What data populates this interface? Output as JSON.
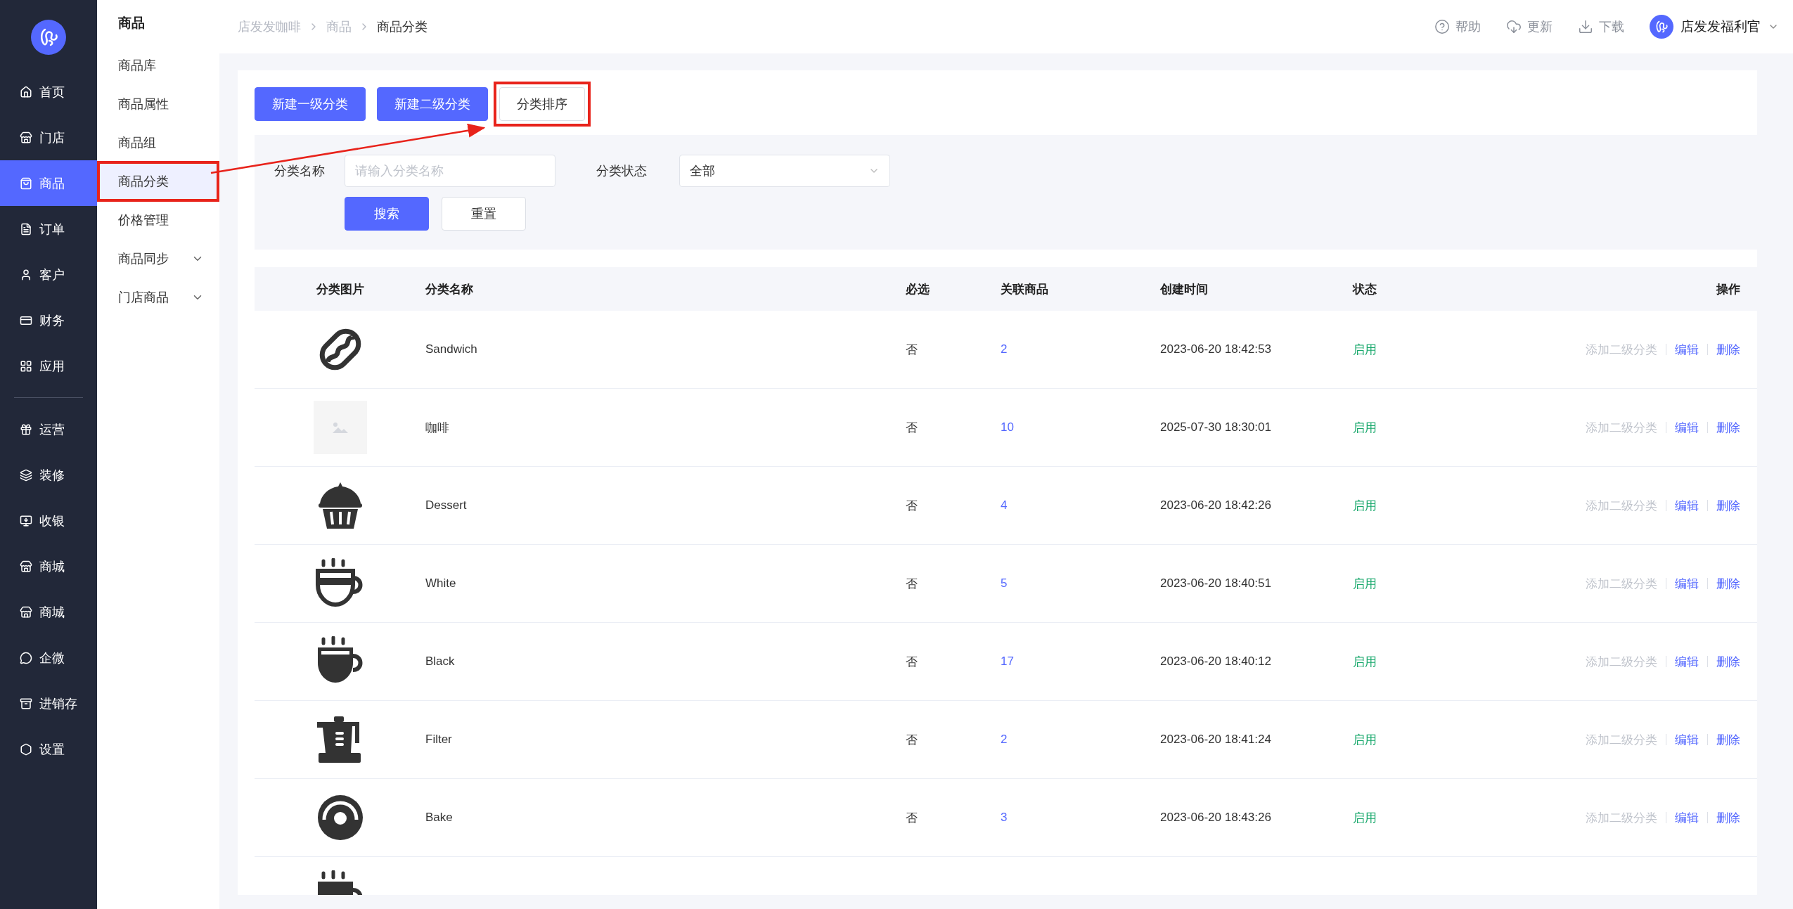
{
  "nav": [
    {
      "label": "首页",
      "selected": false
    },
    {
      "label": "门店",
      "selected": false
    },
    {
      "label": "商品",
      "selected": true
    },
    {
      "label": "订单",
      "selected": false
    },
    {
      "label": "客户",
      "selected": false
    },
    {
      "label": "财务",
      "selected": false
    },
    {
      "label": "应用",
      "selected": false
    },
    {
      "label": "运营",
      "selected": false
    },
    {
      "label": "装修",
      "selected": false
    },
    {
      "label": "收银",
      "selected": false
    },
    {
      "label": "商城",
      "selected": false
    },
    {
      "label": "商城",
      "selected": false
    },
    {
      "label": "企微",
      "selected": false
    },
    {
      "label": "进销存",
      "selected": false
    },
    {
      "label": "设置",
      "selected": false
    }
  ],
  "submenu": {
    "title": "商品",
    "items": [
      {
        "label": "商品库",
        "selected": false,
        "expandable": false,
        "highlighted": false
      },
      {
        "label": "商品属性",
        "selected": false,
        "expandable": false,
        "highlighted": false
      },
      {
        "label": "商品组",
        "selected": false,
        "expandable": false,
        "highlighted": false
      },
      {
        "label": "商品分类",
        "selected": true,
        "expandable": false,
        "highlighted": true
      },
      {
        "label": "价格管理",
        "selected": false,
        "expandable": false,
        "highlighted": false
      },
      {
        "label": "商品同步",
        "selected": false,
        "expandable": true,
        "highlighted": false
      },
      {
        "label": "门店商品",
        "selected": false,
        "expandable": true,
        "highlighted": false
      }
    ]
  },
  "breadcrumb": [
    "店发发咖啡",
    "商品",
    "商品分类"
  ],
  "header_actions": [
    "帮助",
    "更新",
    "下载"
  ],
  "user": {
    "name": "店发发福利官"
  },
  "toolbar": [
    {
      "label": "新建一级分类",
      "kind": "primary",
      "highlighted": false
    },
    {
      "label": "新建二级分类",
      "kind": "primary",
      "highlighted": false
    },
    {
      "label": "分类排序",
      "kind": "default",
      "highlighted": true
    }
  ],
  "filters": {
    "name_label": "分类名称",
    "name_placeholder": "请输入分类名称",
    "status_label": "分类状态",
    "status_value": "全部",
    "search": "搜索",
    "reset": "重置"
  },
  "table": {
    "columns": [
      "分类图片",
      "分类名称",
      "必选",
      "关联商品",
      "创建时间",
      "状态",
      "操作"
    ],
    "rows": [
      {
        "kind": "icon",
        "name": "Sandwich",
        "required": "否",
        "count": "2",
        "created": "2023-06-20 18:42:53",
        "status": "启用",
        "actions": [
          {
            "label": "添加二级分类",
            "disabled": true
          },
          {
            "label": "编辑",
            "disabled": false
          },
          {
            "label": "删除",
            "disabled": false
          }
        ]
      },
      {
        "kind": "empty",
        "name": "咖啡",
        "required": "否",
        "count": "10",
        "created": "2025-07-30 18:30:01",
        "status": "启用",
        "actions": [
          {
            "label": "添加二级分类",
            "disabled": true
          },
          {
            "label": "编辑",
            "disabled": false
          },
          {
            "label": "删除",
            "disabled": false
          }
        ]
      },
      {
        "kind": "icon",
        "name": "Dessert",
        "required": "否",
        "count": "4",
        "created": "2023-06-20 18:42:26",
        "status": "启用",
        "actions": [
          {
            "label": "添加二级分类",
            "disabled": true
          },
          {
            "label": "编辑",
            "disabled": false
          },
          {
            "label": "删除",
            "disabled": false
          }
        ]
      },
      {
        "kind": "icon",
        "name": "White",
        "required": "否",
        "count": "5",
        "created": "2023-06-20 18:40:51",
        "status": "启用",
        "actions": [
          {
            "label": "添加二级分类",
            "disabled": true
          },
          {
            "label": "编辑",
            "disabled": false
          },
          {
            "label": "删除",
            "disabled": false
          }
        ]
      },
      {
        "kind": "icon",
        "name": "Black",
        "required": "否",
        "count": "17",
        "created": "2023-06-20 18:40:12",
        "status": "启用",
        "actions": [
          {
            "label": "添加二级分类",
            "disabled": true
          },
          {
            "label": "编辑",
            "disabled": false
          },
          {
            "label": "删除",
            "disabled": false
          }
        ]
      },
      {
        "kind": "icon",
        "name": "Filter",
        "required": "否",
        "count": "2",
        "created": "2023-06-20 18:41:24",
        "status": "启用",
        "actions": [
          {
            "label": "添加二级分类",
            "disabled": true
          },
          {
            "label": "编辑",
            "disabled": false
          },
          {
            "label": "删除",
            "disabled": false
          }
        ]
      },
      {
        "kind": "icon",
        "name": "Bake",
        "required": "否",
        "count": "3",
        "created": "2023-06-20 18:43:26",
        "status": "启用",
        "actions": [
          {
            "label": "添加二级分类",
            "disabled": true
          },
          {
            "label": "编辑",
            "disabled": false
          },
          {
            "label": "删除",
            "disabled": false
          }
        ]
      },
      {
        "kind": "icon"
      }
    ]
  },
  "callout_arrow": true
}
